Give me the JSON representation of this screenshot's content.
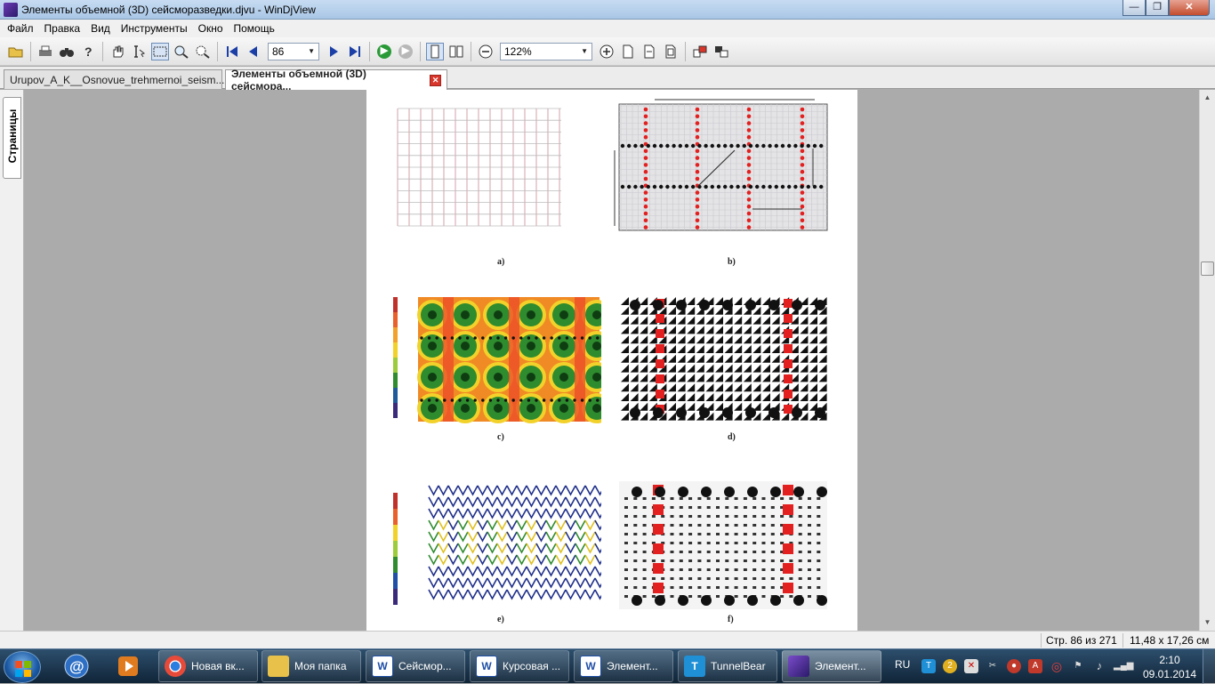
{
  "window": {
    "title": "Элементы объемной (3D) сейсморазведки.djvu - WinDjView",
    "buttons": {
      "minimize": "—",
      "maximize": "❐",
      "close": "✕"
    }
  },
  "menu": [
    "Файл",
    "Правка",
    "Вид",
    "Инструменты",
    "Окно",
    "Помощь"
  ],
  "toolbar": {
    "page_value": "86",
    "zoom_value": "122%"
  },
  "tabs": [
    {
      "label": "Urupov_A_K__Osnovue_trehmernoi_seism...",
      "active": false
    },
    {
      "label": "Элементы объемной (3D) сейсмора...",
      "active": true
    }
  ],
  "sidebar": {
    "label": "Страницы"
  },
  "page": {
    "captions": [
      "a)",
      "b)",
      "c)",
      "d)",
      "e)",
      "f)"
    ]
  },
  "status": {
    "page_info": "Стр. 86 из 271",
    "page_size": "11,48 x 17,26 см"
  },
  "taskbar": {
    "items": [
      {
        "label": "Новая вк...",
        "icon": "chrome-icon"
      },
      {
        "label": "Моя папка",
        "icon": "folder-icon"
      },
      {
        "label": "Сейсмор...",
        "icon": "word-icon"
      },
      {
        "label": "Курсовая ...",
        "icon": "word-icon"
      },
      {
        "label": "Элемент...",
        "icon": "word-icon"
      },
      {
        "label": "TunnelBear",
        "icon": "tunnelbear-icon"
      },
      {
        "label": "Элемент...",
        "icon": "windjview-icon"
      }
    ],
    "language": "RU",
    "time": "2:10",
    "date": "09.01.2014"
  },
  "colors": {
    "accent": "#1b3fa6",
    "grid_line": "#c98a94",
    "source_red": "#e32020",
    "receiver_black": "#111111",
    "heat_green": "#2e8b2e",
    "heat_yellow": "#f2d22a",
    "heat_orange": "#f08a24"
  }
}
